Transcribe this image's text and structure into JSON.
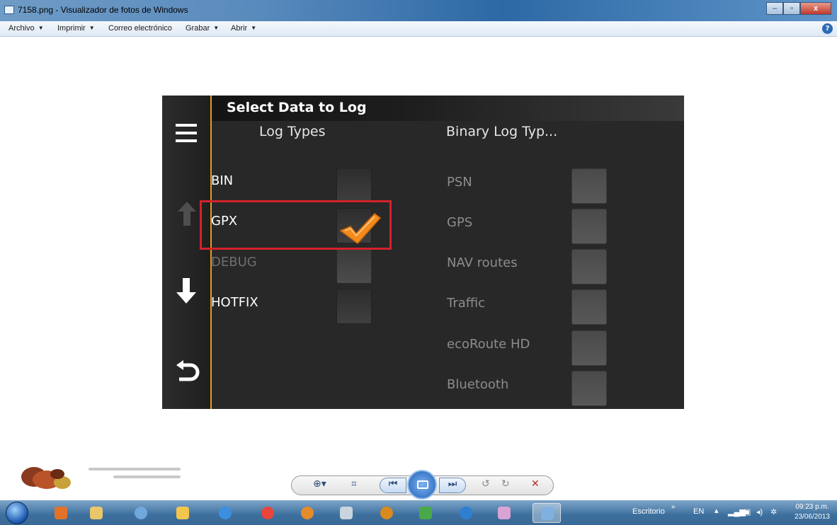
{
  "window": {
    "title": "7158.png - Visualizador de fotos de Windows",
    "min_label": "–",
    "max_label": "▫",
    "close_label": "x"
  },
  "menubar": {
    "items": [
      {
        "label": "Archivo",
        "has_caret": true
      },
      {
        "label": "Imprimir",
        "has_caret": true
      },
      {
        "label": "Correo electrónico",
        "has_caret": false
      },
      {
        "label": "Grabar",
        "has_caret": true
      },
      {
        "label": "Abrir",
        "has_caret": true
      }
    ],
    "help_label": "?"
  },
  "device": {
    "title": "Select Data to Log",
    "col_log_types": "Log Types",
    "col_binary": "Binary Log Typ...",
    "log_types": [
      {
        "label": "BIN",
        "checked": false,
        "enabled": true
      },
      {
        "label": "GPX",
        "checked": true,
        "enabled": true
      },
      {
        "label": "DEBUG",
        "checked": false,
        "enabled": false
      },
      {
        "label": "HOTFIX",
        "checked": false,
        "enabled": true
      }
    ],
    "binary_types": [
      {
        "label": "PSN",
        "checked": false
      },
      {
        "label": "GPS",
        "checked": false
      },
      {
        "label": "NAV routes",
        "checked": false
      },
      {
        "label": "Traffic",
        "checked": false
      },
      {
        "label": "ecoRoute HD",
        "checked": false
      },
      {
        "label": "Bluetooth",
        "checked": false
      }
    ],
    "accent_color": "#e69b22",
    "highlight_color": "#d3222a"
  },
  "viewer_controls": {
    "zoom": "⊕▾",
    "fit": "⌗",
    "prev": "⏮",
    "next": "⏭",
    "rotate_ccw": "↺",
    "rotate_cw": "↻",
    "delete": "✕"
  },
  "taskbar": {
    "desktop_label": "Escritorio",
    "lang": "EN",
    "time": "09:23 p.m.",
    "date": "23/06/2013"
  }
}
